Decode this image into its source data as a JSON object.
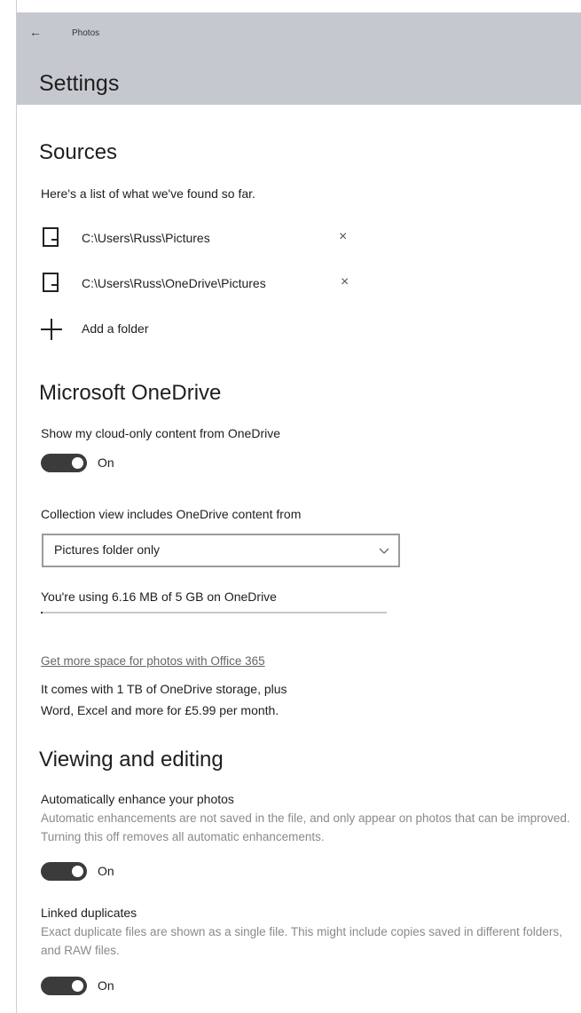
{
  "header": {
    "back_icon": "back-arrow-icon",
    "app_title": "Photos",
    "page_title": "Settings"
  },
  "sources": {
    "heading": "Sources",
    "description": "Here's a list of what we've found so far.",
    "folders": [
      {
        "path": "C:\\Users\\Russ\\Pictures",
        "icon": "folder-icon"
      },
      {
        "path": "C:\\Users\\Russ\\OneDrive\\Pictures",
        "icon": "folder-icon"
      }
    ],
    "remove_glyph": "×",
    "add_label": "Add a folder"
  },
  "onedrive": {
    "heading": "Microsoft OneDrive",
    "cloud_label": "Show my cloud-only content from OneDrive",
    "cloud_toggle_state": "On",
    "collection_label": "Collection view includes OneDrive content from",
    "collection_value": "Pictures folder only",
    "usage_text": "You're using 6.16 MB of 5 GB on OneDrive",
    "usage_fraction": 0.0012,
    "promo_link": "Get more space for photos with Office 365",
    "promo_line1": "It comes with 1 TB of OneDrive storage, plus",
    "promo_line2": "Word, Excel and more for £5.99 per month."
  },
  "viewing": {
    "heading": "Viewing and editing",
    "enhance_label": "Automatically enhance your photos",
    "enhance_desc": "Automatic enhancements are not saved in the file, and only appear on photos that can be improved. Turning this off removes all automatic enhancements.",
    "enhance_toggle_state": "On",
    "duplicates_label": "Linked duplicates",
    "duplicates_desc": "Exact duplicate files are shown as a single file. This might include copies saved in different folders, and RAW files.",
    "duplicates_toggle_state": "On"
  },
  "colors": {
    "header_bg": "#c5c9cf",
    "toggle_on": "#3b3b3b",
    "muted_text": "#8a8a8a"
  }
}
